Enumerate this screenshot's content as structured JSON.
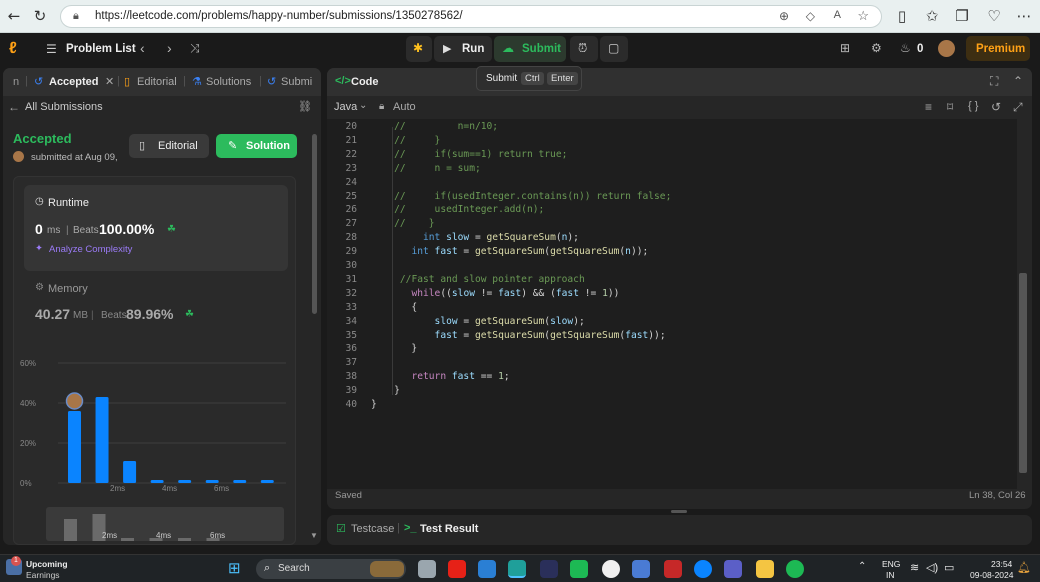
{
  "browser": {
    "url": "https://leetcode.com/problems/happy-number/submissions/1350278562/"
  },
  "nav": {
    "problem_list": "Problem List",
    "run": "Run",
    "submit": "Submit",
    "streak_count": "0",
    "premium": "Premium"
  },
  "tooltip": {
    "label": "Submit",
    "key1": "Ctrl",
    "key2": "Enter"
  },
  "left": {
    "tabs": [
      "n",
      "Accepted",
      "Editorial",
      "Solutions",
      "Submi"
    ],
    "all_submissions": "All Submissions",
    "status": "Accepted",
    "submitted": "submitted at Aug 09,",
    "editorial_btn": "Editorial",
    "solution_btn": "Solution",
    "runtime": {
      "title": "Runtime",
      "value": "0",
      "unit": "ms",
      "beats_label": "Beats",
      "beats_value": "100.00%",
      "analyze": "Analyze Complexity"
    },
    "memory": {
      "title": "Memory",
      "value": "40.27",
      "unit": "MB",
      "beats_label": "Beats",
      "beats_value": "89.96%"
    }
  },
  "chart_data": {
    "type": "bar",
    "y_ticks": [
      "60%",
      "40%",
      "20%",
      "0%"
    ],
    "ylim": [
      0,
      60
    ],
    "x_ticks": [
      "2ms",
      "4ms",
      "6ms"
    ],
    "values": [
      36,
      43,
      11,
      1.5,
      1.5,
      1.5,
      1.5,
      1.5
    ],
    "mini_ticks": [
      "2ms",
      "4ms",
      "6ms"
    ],
    "mini_values": [
      22,
      27,
      3,
      3,
      3,
      3
    ]
  },
  "code": {
    "title": "Code",
    "language": "Java",
    "mode": "Auto",
    "saved": "Saved",
    "cursor": "Ln 38, Col 26",
    "lines": [
      {
        "n": "20",
        "t": "    //         n=n/10;"
      },
      {
        "n": "21",
        "t": "    //     }"
      },
      {
        "n": "22",
        "t": "    //     if(sum==1) return true;"
      },
      {
        "n": "23",
        "t": "    //     n = sum;"
      },
      {
        "n": "24",
        "t": ""
      },
      {
        "n": "25",
        "t": "    //     if(usedInteger.contains(n)) return false;"
      },
      {
        "n": "26",
        "t": "    //     usedInteger.add(n);"
      },
      {
        "n": "27",
        "t": "    //    }"
      },
      {
        "n": "28",
        "t": "         int slow = getSquareSum(n);"
      },
      {
        "n": "29",
        "t": "       int fast = getSquareSum(getSquareSum(n));"
      },
      {
        "n": "30",
        "t": ""
      },
      {
        "n": "31",
        "t": "     //Fast and slow pointer approach"
      },
      {
        "n": "32",
        "t": "       while((slow != fast) && (fast != 1))"
      },
      {
        "n": "33",
        "t": "       {"
      },
      {
        "n": "34",
        "t": "           slow = getSquareSum(slow);"
      },
      {
        "n": "35",
        "t": "           fast = getSquareSum(getSquareSum(fast));"
      },
      {
        "n": "36",
        "t": "       }"
      },
      {
        "n": "37",
        "t": ""
      },
      {
        "n": "38",
        "t": "       return fast == 1;"
      },
      {
        "n": "39",
        "t": "    }"
      },
      {
        "n": "40",
        "t": "}"
      }
    ]
  },
  "bottom": {
    "testcase": "Testcase",
    "test_result": "Test Result"
  },
  "taskbar": {
    "weather_title": "Upcoming",
    "weather_sub": "Earnings",
    "badge": "1",
    "search": "Search",
    "lang1": "ENG",
    "lang2": "IN",
    "time": "23:54",
    "date": "09-08-2024"
  }
}
